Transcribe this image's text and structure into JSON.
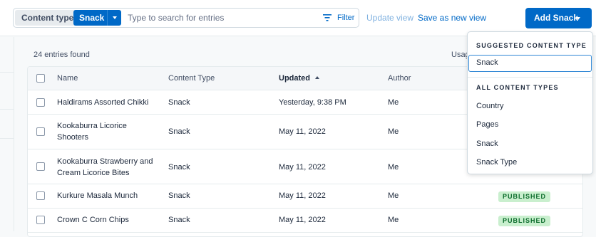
{
  "topbar": {
    "content_type_label": "Content type",
    "content_type_value": "Snack",
    "search_placeholder": "Type to search for entries",
    "filter_label": "Filter",
    "update_view": "Update view",
    "save_as_new_view": "Save as new view",
    "add_button": "Add Snack"
  },
  "summary": {
    "entries_found": "24 entries found",
    "usage_partial": "Usag"
  },
  "table": {
    "headers": {
      "name": "Name",
      "content_type": "Content Type",
      "updated": "Updated",
      "author": "Author"
    },
    "rows": [
      {
        "name": "Haldirams Assorted Chikki",
        "name2": "",
        "content_type": "Snack",
        "updated": "Yesterday, 9:38 PM",
        "author": "Me",
        "status": ""
      },
      {
        "name": "Kookaburra Licorice",
        "name2": "Shooters",
        "content_type": "Snack",
        "updated": "May 11, 2022",
        "author": "Me",
        "status": ""
      },
      {
        "name": "Kookaburra Strawberry and",
        "name2": "Cream Licorice Bites",
        "content_type": "Snack",
        "updated": "May 11, 2022",
        "author": "Me",
        "status": ""
      },
      {
        "name": "Kurkure Masala Munch",
        "name2": "",
        "content_type": "Snack",
        "updated": "May 11, 2022",
        "author": "Me",
        "status": "PUBLISHED"
      },
      {
        "name": "Crown C Corn Chips",
        "name2": "",
        "content_type": "Snack",
        "updated": "May 11, 2022",
        "author": "Me",
        "status": "PUBLISHED"
      }
    ]
  },
  "dropdown": {
    "suggested_heading": "SUGGESTED CONTENT TYPE",
    "suggested_value": "Snack",
    "all_heading": "ALL CONTENT TYPES",
    "items": [
      "Country",
      "Pages",
      "Snack",
      "Snack Type"
    ]
  },
  "colors": {
    "primary": "#0069c7",
    "published_bg": "#c9efce",
    "published_text": "#0a6b2a"
  }
}
